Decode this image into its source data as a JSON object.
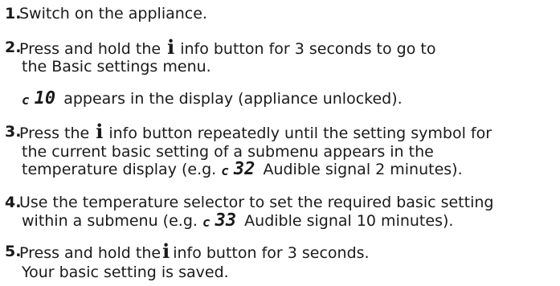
{
  "steps": [
    {
      "number": "1.",
      "lines": [
        "Switch on the appliance."
      ]
    },
    {
      "number": "2.",
      "line1_before": "Press and hold the",
      "line1_after": "info button for 3 seconds to go to",
      "line2": "the Basic settings menu."
    },
    {
      "note_display": "c 10",
      "note_text": "appears in the display (appliance unlocked)."
    },
    {
      "number": "3.",
      "line1_before": "Press the",
      "line1_after": "info button repeatedly until the setting symbol for",
      "line2": "the current basic setting of a submenu appears in the",
      "line3_before": "temperature display (e.g.",
      "line3_display": "c 32",
      "line3_after": "Audible signal 2 minutes)."
    },
    {
      "number": "4.",
      "line1": "Use the temperature selector to set the required basic setting",
      "line2_before": "within a submenu (e.g.",
      "line2_display": "c 33",
      "line2_after": "Audible signal 10 minutes)."
    },
    {
      "number": "5.",
      "line1_before": "Press and hold the",
      "line1_after": "info button for 3 seconds.",
      "line2": "Your basic setting is saved."
    }
  ],
  "info_symbol": "i",
  "display_segments": {
    "c10": {
      "c": "c",
      "digits": "10"
    },
    "c32": {
      "c": "c",
      "digits": "32"
    },
    "c33": {
      "c": "c",
      "digits": "33"
    }
  }
}
